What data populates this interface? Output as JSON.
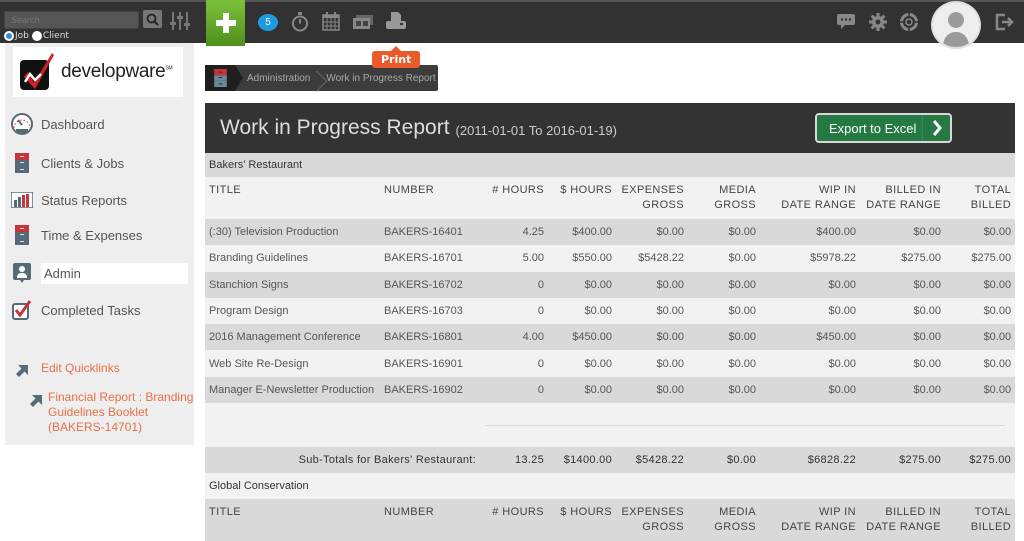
{
  "topbar": {
    "search_placeholder": "Search",
    "radio_job": "Job",
    "radio_client": "Client",
    "notification_count": "5",
    "print_tooltip": "Print"
  },
  "sidebar": {
    "logo_text": "developware",
    "logo_tm": "SM",
    "items": [
      {
        "label": "Dashboard",
        "icon": "dashboard-icon"
      },
      {
        "label": "Clients & Jobs",
        "icon": "cabinet-icon"
      },
      {
        "label": "Status Reports",
        "icon": "bar-chart-icon"
      },
      {
        "label": "Time & Expenses",
        "icon": "cabinet-icon"
      },
      {
        "label": "Admin",
        "icon": "admin-icon",
        "active": true
      },
      {
        "label": "Completed Tasks",
        "icon": "checkbox-icon"
      }
    ],
    "quicklinks": {
      "edit_label": "Edit Quicklinks",
      "links": [
        {
          "line1": "Financial Report : Branding",
          "line2": "Guidelines Booklet",
          "line3": "(BAKERS-14701)"
        }
      ]
    }
  },
  "breadcrumb": [
    "Administration",
    "Work in Progress Report"
  ],
  "report": {
    "title": "Work in Progress Report",
    "range": "(2011-01-01 To 2016-01-19)",
    "export_label": "Export to Excel",
    "columns": [
      [
        "TITLE",
        ""
      ],
      [
        "NUMBER",
        ""
      ],
      [
        "# HOURS",
        ""
      ],
      [
        "$ HOURS",
        ""
      ],
      [
        "EXPENSES",
        "GROSS"
      ],
      [
        "MEDIA",
        "GROSS"
      ],
      [
        "WIP IN",
        "DATE RANGE"
      ],
      [
        "BILLED IN",
        "DATE RANGE"
      ],
      [
        "TOTAL",
        "BILLED"
      ]
    ],
    "clients": [
      {
        "name": "Bakers' Restaurant",
        "rows": [
          [
            "(:30) Television Production",
            "BAKERS-16401",
            "4.25",
            "$400.00",
            "$0.00",
            "$0.00",
            "$400.00",
            "$0.00",
            "$0.00"
          ],
          [
            "Branding Guidelines",
            "BAKERS-16701",
            "5.00",
            "$550.00",
            "$5428.22",
            "$0.00",
            "$5978.22",
            "$275.00",
            "$275.00"
          ],
          [
            "Stanchion Signs",
            "BAKERS-16702",
            "0",
            "$0.00",
            "$0.00",
            "$0.00",
            "$0.00",
            "$0.00",
            "$0.00"
          ],
          [
            "Program Design",
            "BAKERS-16703",
            "0",
            "$0.00",
            "$0.00",
            "$0.00",
            "$0.00",
            "$0.00",
            "$0.00"
          ],
          [
            "2016 Management Conference",
            "BAKERS-16801",
            "4.00",
            "$450.00",
            "$0.00",
            "$0.00",
            "$450.00",
            "$0.00",
            "$0.00"
          ],
          [
            "Web Site Re-Design",
            "BAKERS-16901",
            "0",
            "$0.00",
            "$0.00",
            "$0.00",
            "$0.00",
            "$0.00",
            "$0.00"
          ],
          [
            "Manager E-Newsletter Production",
            "BAKERS-16902",
            "0",
            "$0.00",
            "$0.00",
            "$0.00",
            "$0.00",
            "$0.00",
            "$0.00"
          ]
        ],
        "subtotal_label": "Sub-Totals for Bakers' Restaurant:",
        "subtotals": [
          "13.25",
          "$1400.00",
          "$5428.22",
          "$0.00",
          "$6828.22",
          "$275.00",
          "$275.00"
        ]
      },
      {
        "name": "Global Conservation"
      }
    ]
  },
  "colors": {
    "accent_link": "#e8704a",
    "topbar": "#323232",
    "add_button": "#6aab2e",
    "export_button": "#257a43",
    "tooltip": "#ea5a2a"
  }
}
